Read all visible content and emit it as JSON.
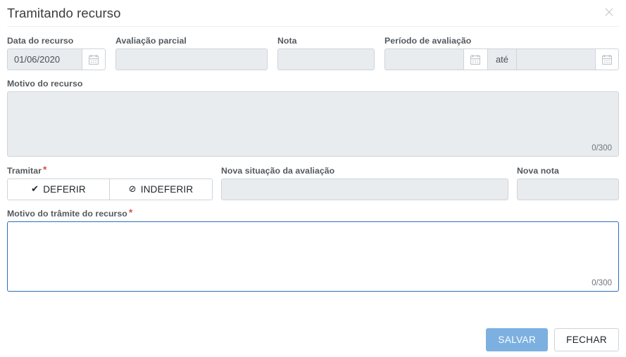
{
  "modal": {
    "title": "Tramitando recurso",
    "close_icon": "close-icon",
    "close_label": "×"
  },
  "fields": {
    "data_recurso": {
      "label": "Data do recurso",
      "value": "01/06/2020",
      "placeholder": "",
      "calendar_icon": "calendar-icon"
    },
    "avaliacao_parcial": {
      "label": "Avaliação parcial",
      "value": "",
      "placeholder": ""
    },
    "nota": {
      "label": "Nota",
      "value": "",
      "placeholder": ""
    },
    "periodo_avaliacao": {
      "label": "Período de avaliação",
      "start_value": "",
      "start_placeholder": "",
      "separator": "até",
      "end_value": "",
      "end_placeholder": "",
      "calendar_icon": "calendar-icon"
    },
    "motivo_recurso": {
      "label": "Motivo do recurso",
      "value": "",
      "placeholder": "",
      "counter": "0/300"
    },
    "tramitar": {
      "label": "Tramitar",
      "required_mark": "*",
      "options": [
        {
          "label": "DEFERIR",
          "icon": "check-icon",
          "glyph": "✔"
        },
        {
          "label": "INDEFERIR",
          "icon": "ban-icon",
          "glyph": "⊘"
        }
      ]
    },
    "nova_situacao": {
      "label": "Nova situação da avaliação",
      "value": "",
      "placeholder": ""
    },
    "nova_nota": {
      "label": "Nova nota",
      "value": "",
      "placeholder": ""
    },
    "motivo_tramite": {
      "label": "Motivo do trâmite do recurso",
      "required_mark": "*",
      "value": "",
      "placeholder": "",
      "counter": "0/300"
    }
  },
  "footer": {
    "save_label": "SALVAR",
    "close_label": "FECHAR"
  },
  "colors": {
    "accent": "#7cb0e0",
    "focus_border": "#2a6ebb",
    "required": "#d9534f",
    "disabled_bg": "#e9ecef",
    "border": "#ced4da",
    "label_text": "#54595e"
  }
}
